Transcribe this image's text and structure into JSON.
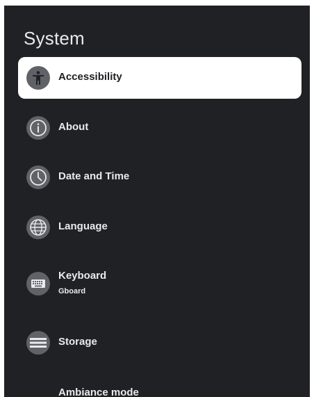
{
  "header": {
    "title": "System"
  },
  "items": [
    {
      "label": "Accessibility",
      "icon": "accessibility-icon",
      "selected": true
    },
    {
      "label": "About",
      "icon": "info-icon"
    },
    {
      "label": "Date and Time",
      "icon": "clock-icon"
    },
    {
      "label": "Language",
      "icon": "globe-icon"
    },
    {
      "label": "Keyboard",
      "sublabel": "Gboard",
      "icon": "keyboard-icon"
    },
    {
      "label": "Storage",
      "icon": "storage-icon"
    },
    {
      "label": "Ambiance mode"
    }
  ],
  "colors": {
    "background": "#202124",
    "selected": "#ffffff",
    "icon_circle": "#5f6368",
    "text": "#e8eaed"
  }
}
